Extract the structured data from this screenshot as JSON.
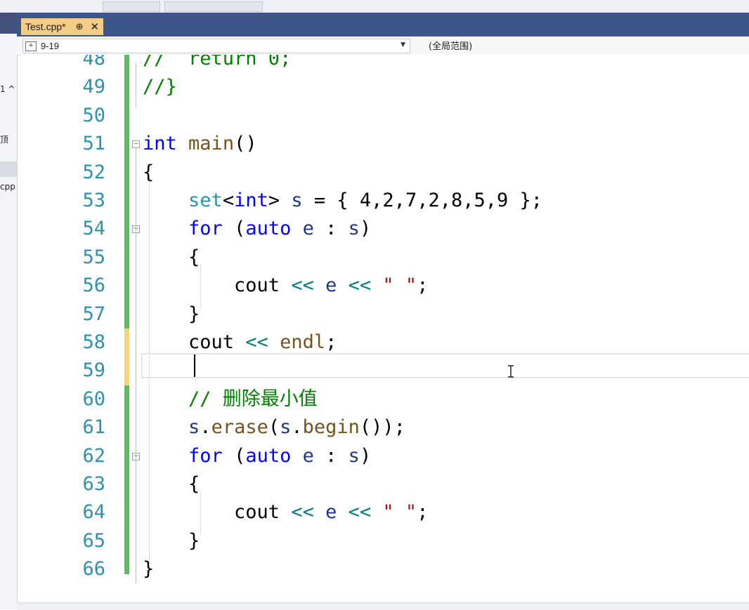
{
  "left_panel": {
    "snippets": [
      "1 ^",
      "顶",
      "cpp"
    ]
  },
  "tab": {
    "label": "Test.cpp*",
    "pin": "⊕",
    "close": "✕"
  },
  "navbar": {
    "project": "9-19",
    "scope": "(全局范围)"
  },
  "editor": {
    "lines": [
      {
        "num": "48",
        "tokens": [
          {
            "t": "//  return 0;",
            "c": "cm"
          }
        ]
      },
      {
        "num": "49",
        "tokens": [
          {
            "t": "//}",
            "c": "cm"
          }
        ]
      },
      {
        "num": "50",
        "tokens": []
      },
      {
        "num": "51",
        "tokens": [
          {
            "t": "int",
            "c": "kw"
          },
          {
            "t": " ",
            "c": "pu"
          },
          {
            "t": "main",
            "c": "fn"
          },
          {
            "t": "()",
            "c": "pu"
          }
        ]
      },
      {
        "num": "52",
        "tokens": [
          {
            "t": "{",
            "c": "pu"
          }
        ]
      },
      {
        "num": "53",
        "tokens": [
          {
            "t": "    ",
            "c": "pu"
          },
          {
            "t": "set",
            "c": "ty"
          },
          {
            "t": "<",
            "c": "pu"
          },
          {
            "t": "int",
            "c": "kw"
          },
          {
            "t": "> ",
            "c": "pu"
          },
          {
            "t": "s",
            "c": "vr"
          },
          {
            "t": " = { 4,2,7,2,8,5,9 };",
            "c": "pu"
          }
        ]
      },
      {
        "num": "54",
        "tokens": [
          {
            "t": "    ",
            "c": "pu"
          },
          {
            "t": "for",
            "c": "kw"
          },
          {
            "t": " (",
            "c": "pu"
          },
          {
            "t": "auto",
            "c": "kw"
          },
          {
            "t": " ",
            "c": "pu"
          },
          {
            "t": "e",
            "c": "vr"
          },
          {
            "t": " : ",
            "c": "pu"
          },
          {
            "t": "s",
            "c": "vr"
          },
          {
            "t": ")",
            "c": "pu"
          }
        ]
      },
      {
        "num": "55",
        "tokens": [
          {
            "t": "    {",
            "c": "pu"
          }
        ]
      },
      {
        "num": "56",
        "tokens": [
          {
            "t": "        cout ",
            "c": "pu"
          },
          {
            "t": "<<",
            "c": "op"
          },
          {
            "t": " ",
            "c": "pu"
          },
          {
            "t": "e",
            "c": "vr"
          },
          {
            "t": " ",
            "c": "pu"
          },
          {
            "t": "<<",
            "c": "op"
          },
          {
            "t": " ",
            "c": "pu"
          },
          {
            "t": "\" \"",
            "c": "st"
          },
          {
            "t": ";",
            "c": "pu"
          }
        ]
      },
      {
        "num": "57",
        "tokens": [
          {
            "t": "    }",
            "c": "pu"
          }
        ]
      },
      {
        "num": "58",
        "tokens": [
          {
            "t": "    cout ",
            "c": "pu"
          },
          {
            "t": "<<",
            "c": "op"
          },
          {
            "t": " ",
            "c": "pu"
          },
          {
            "t": "endl",
            "c": "fn"
          },
          {
            "t": ";",
            "c": "pu"
          }
        ]
      },
      {
        "num": "59",
        "tokens": []
      },
      {
        "num": "60",
        "tokens": [
          {
            "t": "    ",
            "c": "pu"
          },
          {
            "t": "// 删除最小值",
            "c": "cm"
          }
        ]
      },
      {
        "num": "61",
        "tokens": [
          {
            "t": "    ",
            "c": "pu"
          },
          {
            "t": "s",
            "c": "vr"
          },
          {
            "t": ".",
            "c": "pu"
          },
          {
            "t": "erase",
            "c": "fn"
          },
          {
            "t": "(",
            "c": "pu"
          },
          {
            "t": "s",
            "c": "vr"
          },
          {
            "t": ".",
            "c": "pu"
          },
          {
            "t": "begin",
            "c": "fn"
          },
          {
            "t": "());",
            "c": "pu"
          }
        ]
      },
      {
        "num": "62",
        "tokens": [
          {
            "t": "    ",
            "c": "pu"
          },
          {
            "t": "for",
            "c": "kw"
          },
          {
            "t": " (",
            "c": "pu"
          },
          {
            "t": "auto",
            "c": "kw"
          },
          {
            "t": " ",
            "c": "pu"
          },
          {
            "t": "e",
            "c": "vr"
          },
          {
            "t": " : ",
            "c": "pu"
          },
          {
            "t": "s",
            "c": "vr"
          },
          {
            "t": ")",
            "c": "pu"
          }
        ]
      },
      {
        "num": "63",
        "tokens": [
          {
            "t": "    {",
            "c": "pu"
          }
        ]
      },
      {
        "num": "64",
        "tokens": [
          {
            "t": "        cout ",
            "c": "pu"
          },
          {
            "t": "<<",
            "c": "op"
          },
          {
            "t": " ",
            "c": "pu"
          },
          {
            "t": "e",
            "c": "vr"
          },
          {
            "t": " ",
            "c": "pu"
          },
          {
            "t": "<<",
            "c": "op"
          },
          {
            "t": " ",
            "c": "pu"
          },
          {
            "t": "\" \"",
            "c": "st"
          },
          {
            "t": ";",
            "c": "pu"
          }
        ]
      },
      {
        "num": "65",
        "tokens": [
          {
            "t": "    }",
            "c": "pu"
          }
        ]
      },
      {
        "num": "66",
        "tokens": [
          {
            "t": "}",
            "c": "pu"
          }
        ]
      }
    ]
  },
  "colors": {
    "tab_active": "#f5cc84",
    "tab_strip": "#3d5588",
    "line_number": "#2b91af",
    "change_saved": "#57c05a",
    "change_unsaved": "#f5d76e"
  }
}
